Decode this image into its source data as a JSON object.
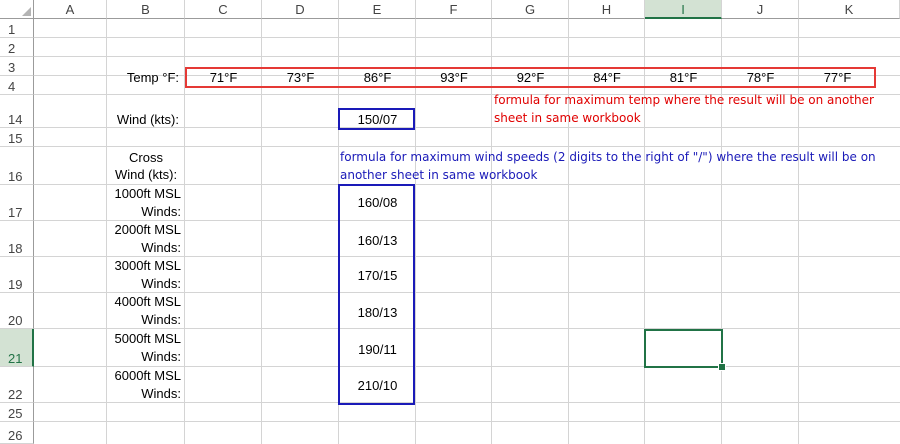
{
  "columns": [
    "A",
    "B",
    "C",
    "D",
    "E",
    "F",
    "G",
    "H",
    "I",
    "J",
    "K"
  ],
  "rows": [
    "1",
    "2",
    "3",
    "4",
    "14",
    "15",
    "16",
    "17",
    "18",
    "19",
    "20",
    "21",
    "22",
    "25",
    "26"
  ],
  "selected": {
    "column": "I",
    "row": "21"
  },
  "cells": {
    "B3": "Temp °F:",
    "temps": [
      "71°F",
      "73°F",
      "86°F",
      "93°F",
      "92°F",
      "84°F",
      "81°F",
      "78°F",
      "77°F"
    ],
    "B14": "Wind (kts):",
    "E14": "150/07",
    "B16_line1": "Cross",
    "B16_line2": "Wind (kts):",
    "wind_labels": [
      {
        "line1": "1000ft MSL",
        "line2": "Winds:"
      },
      {
        "line1": "2000ft MSL",
        "line2": "Winds:"
      },
      {
        "line1": "3000ft MSL",
        "line2": "Winds:"
      },
      {
        "line1": "4000ft MSL",
        "line2": "Winds:"
      },
      {
        "line1": "5000ft MSL",
        "line2": "Winds:"
      },
      {
        "line1": "6000ft MSL",
        "line2": "Winds:"
      }
    ],
    "wind_values": [
      "160/08",
      "160/13",
      "170/15",
      "180/13",
      "190/11",
      "210/10"
    ]
  },
  "notes": {
    "red_line1": "formula for maximum temp where the result will be on another",
    "red_line2": "sheet in same workbook",
    "blue_line1": "formula for maximum wind speeds (2 digits to the right of \"/\") where the result will be on",
    "blue_line2": "another sheet in same workbook"
  },
  "colors": {
    "red_box": "#e53935",
    "blue_box": "#1a1ab8",
    "selection": "#217346",
    "note_red": "#e00000",
    "note_blue": "#1a1ab8"
  }
}
